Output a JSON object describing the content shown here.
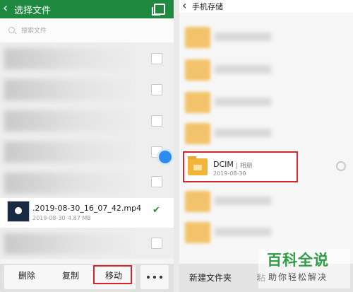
{
  "left": {
    "header": {
      "title": "选择文件",
      "back_glyph": "‹"
    },
    "search": {
      "placeholder": "搜索文件"
    },
    "file": {
      "name": ".2019-08-30_16_07_42.mp4",
      "date": "2019-08-30",
      "size": "4.87 MB"
    },
    "toolbar": {
      "delete": "删除",
      "copy": "复制",
      "move": "移动",
      "more": "more-dots"
    }
  },
  "right": {
    "header": {
      "title": "手机存储",
      "back_glyph": "‹"
    },
    "dcim": {
      "name": "DCIM",
      "tag": "| 相册",
      "date": "2019-08-30"
    },
    "toolbar": {
      "new_folder": "新建文件夹",
      "partial": "粘"
    }
  },
  "watermark": {
    "line1": "百科全说",
    "line2": "助你轻松解决"
  },
  "colors": {
    "header_green": "#1f8a3f",
    "highlight_red": "#d0282e",
    "selected_blue": "#2d8cf0"
  }
}
